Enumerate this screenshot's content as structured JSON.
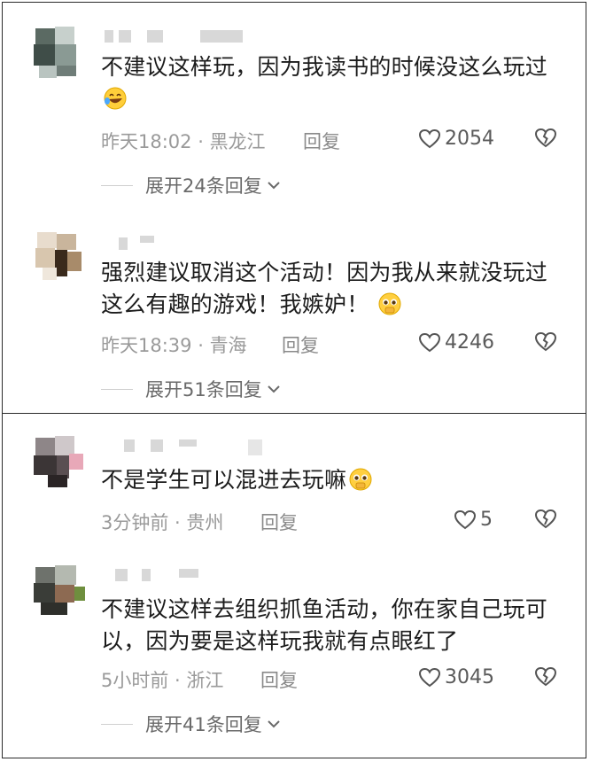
{
  "comments": [
    {
      "text": "不建议这样玩，因为我读书的时候没这么玩过",
      "emoji": "rofl-emoji",
      "time": "昨天18:02",
      "location": "黑龙江",
      "reply": "回复",
      "likes": "2054",
      "expand": "展开24条回复"
    },
    {
      "text": "强烈建议取消这个活动！因为我从来就没玩过这么有趣的游戏！我嫉妒！",
      "emoji": "pleading-emoji",
      "time": "昨天18:39",
      "location": "青海",
      "reply": "回复",
      "likes": "4246",
      "expand": "展开51条回复"
    },
    {
      "text": "不是学生可以混进去玩嘛",
      "emoji": "pleading-emoji",
      "time": "3分钟前",
      "location": "贵州",
      "reply": "回复",
      "likes": "5"
    },
    {
      "text": "不建议这样去组织抓鱼活动，你在家自己玩可以，因为要是这样玩我就有点眼红了",
      "time": "5小时前",
      "location": "浙江",
      "reply": "回复",
      "likes": "3045",
      "expand": "展开41条回复"
    }
  ],
  "separator": " · ",
  "colors": {
    "text": "#1c1c1c",
    "meta": "#9a9a9a",
    "border": "#2a2a2a"
  }
}
